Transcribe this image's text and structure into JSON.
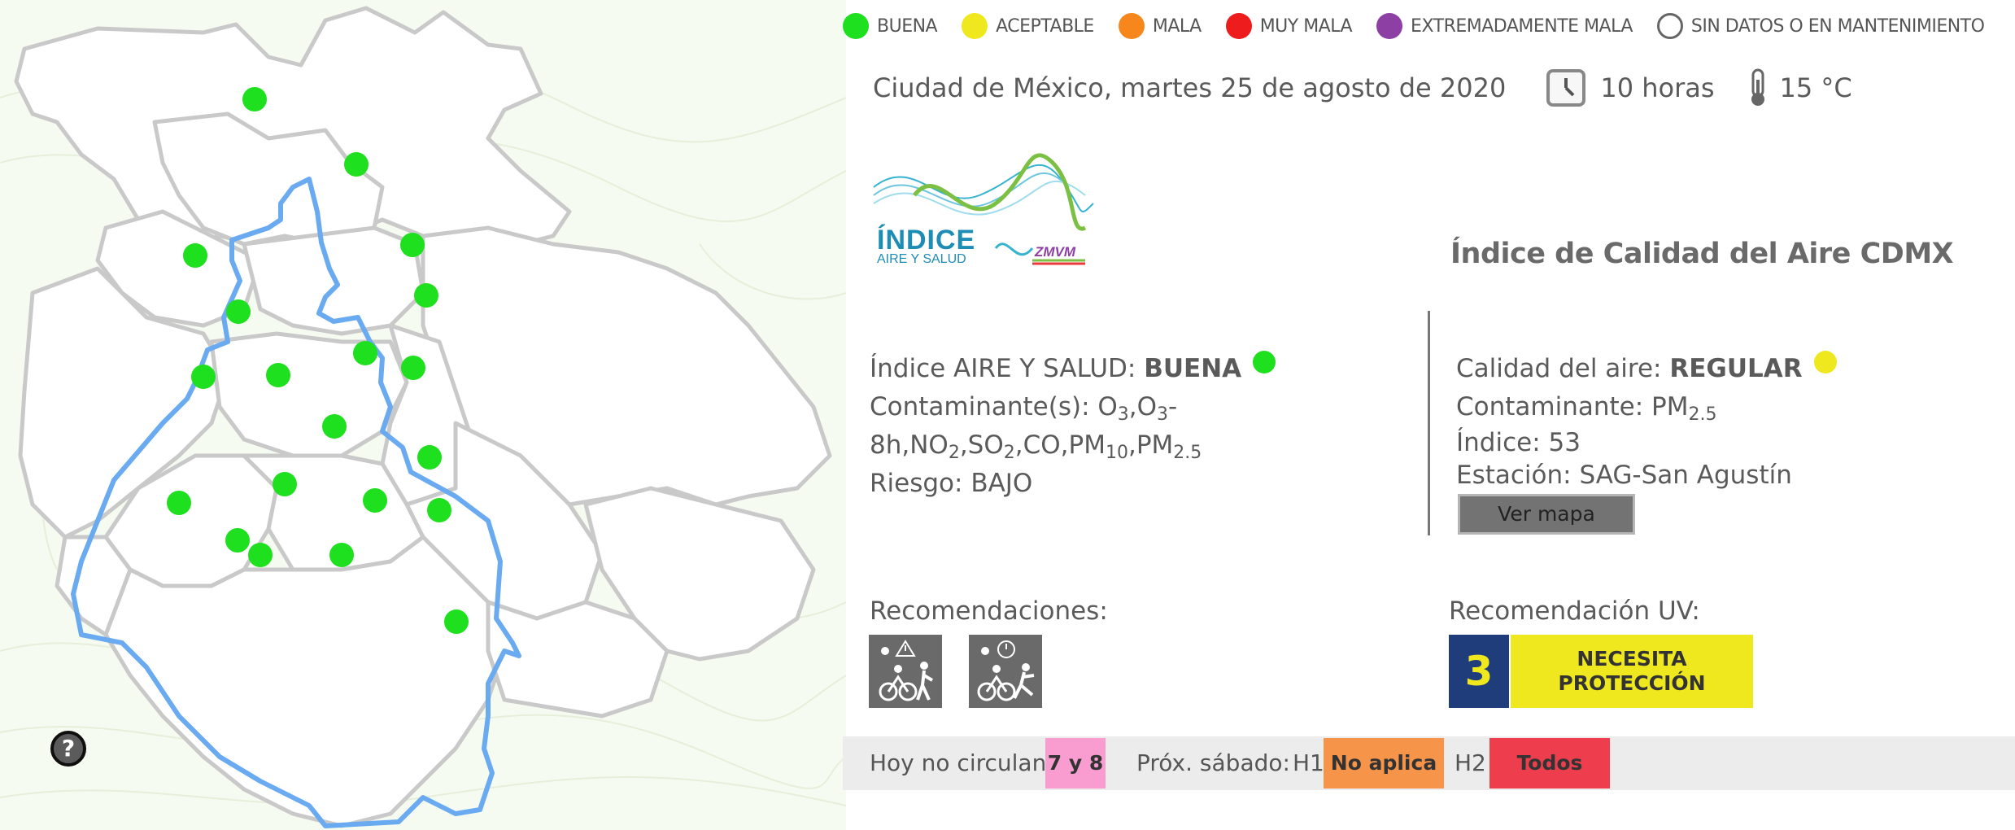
{
  "legend": {
    "items": [
      {
        "label": "BUENA",
        "color": "#1ee01e",
        "icon": "circle-filled"
      },
      {
        "label": "ACEPTABLE",
        "color": "#f0e81e",
        "icon": "circle-filled"
      },
      {
        "label": "MALA",
        "color": "#f7861c",
        "icon": "circle-filled"
      },
      {
        "label": "MUY MALA",
        "color": "#ee1c1c",
        "icon": "circle-filled"
      },
      {
        "label": "EXTREMADAMENTE MALA",
        "color": "#8e3fa3",
        "icon": "circle-filled"
      },
      {
        "label": "SIN DATOS O EN MANTENIMIENTO",
        "color": "#ffffff",
        "icon": "circle-outline"
      }
    ]
  },
  "header": {
    "date": "Ciudad de México, martes 25 de agosto de 2020",
    "time_icon": "clock-icon",
    "time": "10 horas",
    "temp_icon": "thermometer-icon",
    "temp": "15 °C"
  },
  "logo": {
    "line1": "ÍNDICE",
    "line2": "AIRE Y SALUD",
    "line3": "ZMVM"
  },
  "aqi_title": "Índice de Calidad del Aire CDMX",
  "indice_aire_salud": {
    "label": "Índice AIRE Y SALUD: ",
    "value": "BUENA",
    "value_color": "#1ee01e",
    "contaminantes_line1": "Contaminante(s): O3,O3-",
    "contaminantes_line2": "8h,NO2,SO2,CO,PM10,PM2.5",
    "riesgo": "Riesgo: BAJO"
  },
  "calidad_aire": {
    "label": "Calidad del aire: ",
    "value": "REGULAR",
    "value_color": "#f0e81e",
    "contaminante": "Contaminante: PM2.5",
    "indice": "Índice: 53",
    "estacion": "Estación: SAG-San Agustín",
    "map_button": "Ver mapa"
  },
  "recomendaciones": {
    "title": "Recomendaciones:",
    "icons": [
      "cyclist-pedestrian-warning-icon",
      "cyclist-runner-clock-icon"
    ]
  },
  "uv": {
    "title": "Recomendación UV:",
    "index": "3",
    "label_line1": "NECESITA",
    "label_line2": "PROTECCIÓN",
    "index_bg": "#1f3d7b",
    "label_bg": "#f0e81e"
  },
  "hoy_no_circula": {
    "label": "Hoy no circulan:",
    "value": "7 y 8",
    "value_bg": "#f99dd0",
    "sabado_label": "Próx. sábado:",
    "h1_label": "H1",
    "h1_value": "No aplica",
    "h1_bg": "#f6954a",
    "h2_label": "H2",
    "h2_value": "Todos",
    "h2_bg": "#ee3e4d"
  },
  "map": {
    "help_label": "?",
    "station_color": "#1ee01e",
    "boundary_color": "#6aaaf0"
  }
}
